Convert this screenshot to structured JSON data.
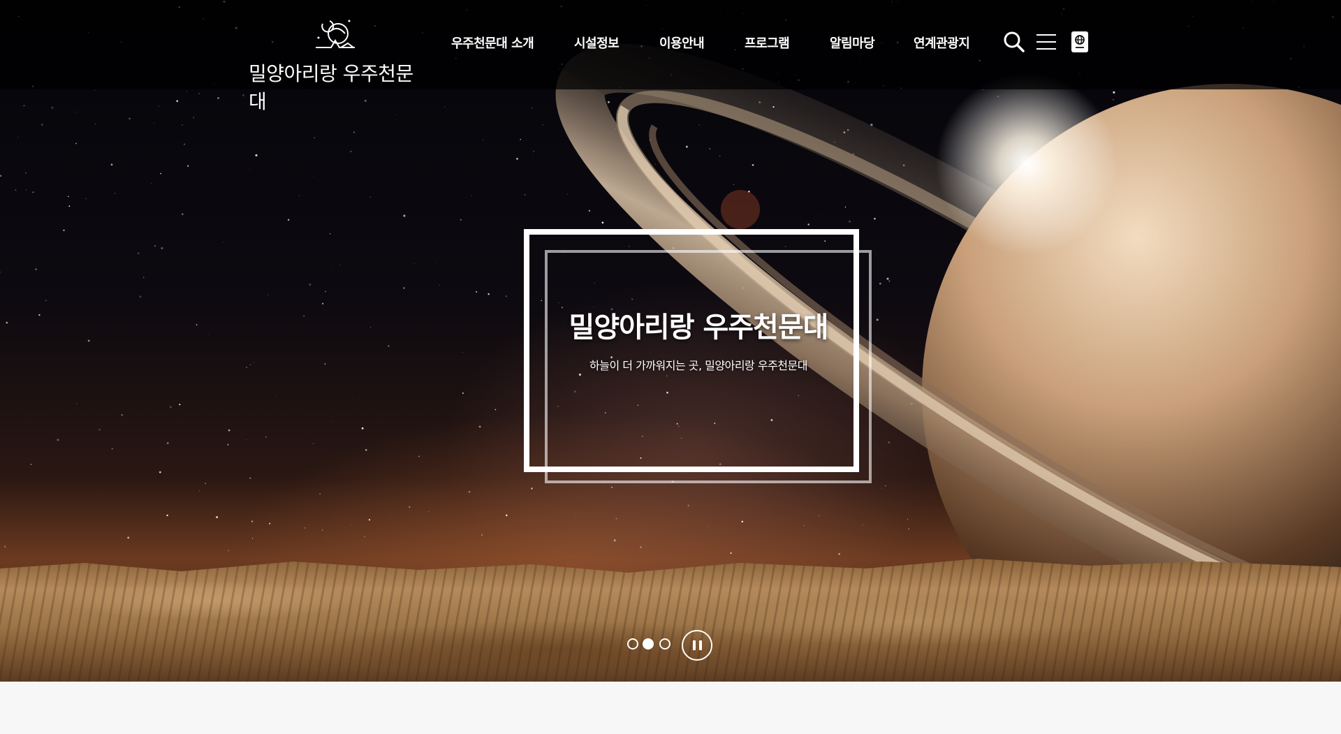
{
  "site": {
    "logo_text": "밀양아리랑 우주천문대"
  },
  "nav": {
    "items": [
      {
        "label": "우주천문대 소개"
      },
      {
        "label": "시설정보"
      },
      {
        "label": "이용안내"
      },
      {
        "label": "프로그램"
      },
      {
        "label": "알림마당"
      },
      {
        "label": "연계관광지"
      }
    ]
  },
  "tools": {
    "icons": [
      "search-icon",
      "menu-icon",
      "passport-icon"
    ]
  },
  "hero": {
    "title": "밀양아리랑 우주천문대",
    "subtitle": "하늘이 더 가까워지는 곳, 밀양아리랑 우주천문대"
  },
  "slider": {
    "slide_count": 3,
    "active_index": 1,
    "control_icon": "pause-icon"
  },
  "colors": {
    "header_bg": "#000000",
    "text": "#ffffff",
    "footer_bg": "#f7f7f7"
  }
}
